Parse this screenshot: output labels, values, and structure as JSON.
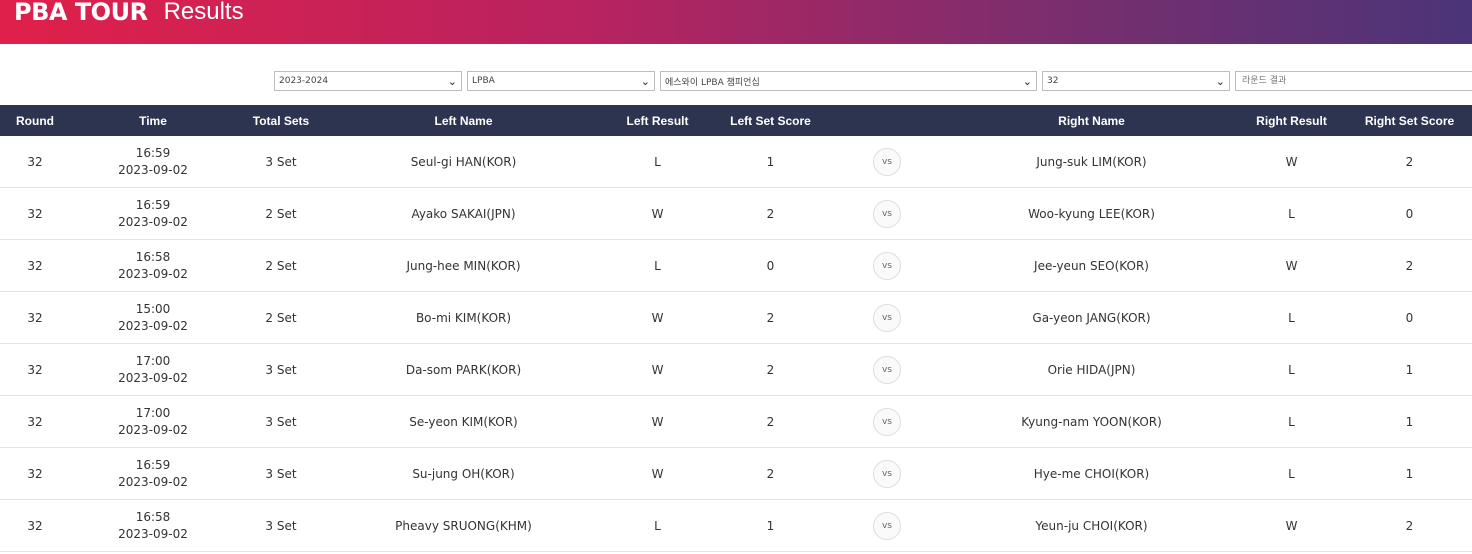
{
  "header": {
    "logo": "PBA TOUR",
    "title": "Results"
  },
  "filters": {
    "season": "2023-2024",
    "league": "LPBA",
    "tournament": "에스와이 LPBA 챔피언십",
    "round": "32",
    "results_placeholder": "라운드 결과"
  },
  "table": {
    "columns": [
      "Round",
      "Time",
      "Total Sets",
      "Left Name",
      "Left Result",
      "Left Set Score",
      "",
      "Right Name",
      "Right Result",
      "Right Set Score"
    ],
    "vs_label": "vs",
    "rows": [
      {
        "round": "32",
        "time": "16:59",
        "date": "2023-09-02",
        "sets": "3 Set",
        "left": "Seul-gi HAN(KOR)",
        "lres": "L",
        "lscore": "1",
        "right": "Jung-suk LIM(KOR)",
        "rres": "W",
        "rscore": "2"
      },
      {
        "round": "32",
        "time": "16:59",
        "date": "2023-09-02",
        "sets": "2 Set",
        "left": "Ayako SAKAI(JPN)",
        "lres": "W",
        "lscore": "2",
        "right": "Woo-kyung LEE(KOR)",
        "rres": "L",
        "rscore": "0"
      },
      {
        "round": "32",
        "time": "16:58",
        "date": "2023-09-02",
        "sets": "2 Set",
        "left": "Jung-hee MIN(KOR)",
        "lres": "L",
        "lscore": "0",
        "right": "Jee-yeun SEO(KOR)",
        "rres": "W",
        "rscore": "2"
      },
      {
        "round": "32",
        "time": "15:00",
        "date": "2023-09-02",
        "sets": "2 Set",
        "left": "Bo-mi KIM(KOR)",
        "lres": "W",
        "lscore": "2",
        "right": "Ga-yeon JANG(KOR)",
        "rres": "L",
        "rscore": "0"
      },
      {
        "round": "32",
        "time": "17:00",
        "date": "2023-09-02",
        "sets": "3 Set",
        "left": "Da-som PARK(KOR)",
        "lres": "W",
        "lscore": "2",
        "right": "Orie HIDA(JPN)",
        "rres": "L",
        "rscore": "1"
      },
      {
        "round": "32",
        "time": "17:00",
        "date": "2023-09-02",
        "sets": "3 Set",
        "left": "Se-yeon KIM(KOR)",
        "lres": "W",
        "lscore": "2",
        "right": "Kyung-nam YOON(KOR)",
        "rres": "L",
        "rscore": "1"
      },
      {
        "round": "32",
        "time": "16:59",
        "date": "2023-09-02",
        "sets": "3 Set",
        "left": "Su-jung OH(KOR)",
        "lres": "W",
        "lscore": "2",
        "right": "Hye-me CHOI(KOR)",
        "rres": "L",
        "rscore": "1"
      },
      {
        "round": "32",
        "time": "16:58",
        "date": "2023-09-02",
        "sets": "3 Set",
        "left": "Pheavy SRUONG(KHM)",
        "lres": "L",
        "lscore": "1",
        "right": "Yeun-ju CHOI(KOR)",
        "rres": "W",
        "rscore": "2"
      }
    ]
  }
}
